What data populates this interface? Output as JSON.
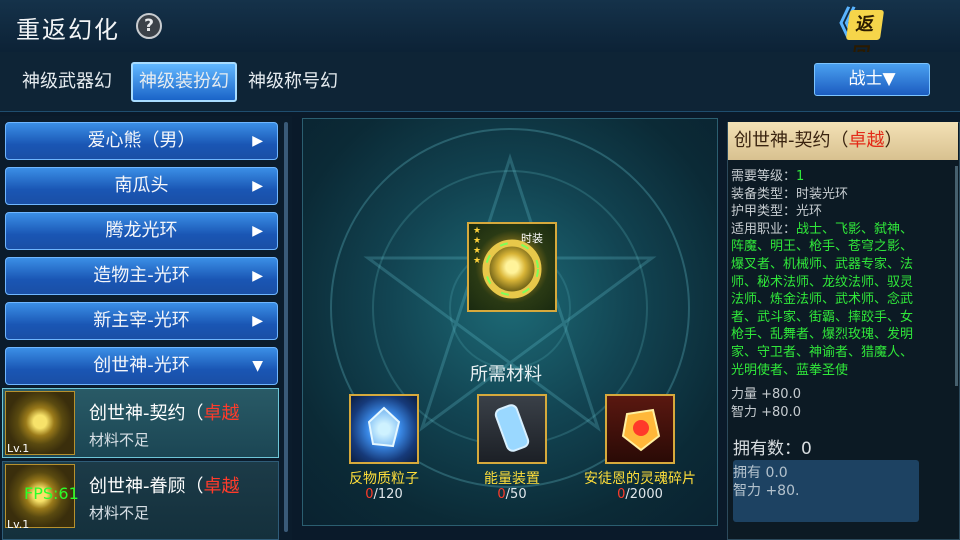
{
  "header": {
    "title": "重返幻化",
    "help_icon": "question-icon",
    "help_glyph": "?",
    "back_label": "返回",
    "back_arrows": "《"
  },
  "tabs": [
    {
      "label": "神级武器幻",
      "active": false
    },
    {
      "label": "神级装扮幻",
      "active": true
    },
    {
      "label": "神级称号幻",
      "active": false
    }
  ],
  "class_dropdown": {
    "label": "战士▼"
  },
  "list": {
    "categories": [
      {
        "label": "爱心熊（男）",
        "arrow": "▶"
      },
      {
        "label": "南瓜头",
        "arrow": "▶"
      },
      {
        "label": "腾龙光环",
        "arrow": "▶"
      },
      {
        "label": "造物主-光环",
        "arrow": "▶"
      },
      {
        "label": "新主宰-光环",
        "arrow": "▶"
      },
      {
        "label": "创世神-光环",
        "arrow": "▼"
      }
    ],
    "items": [
      {
        "name": "创世神-契约（",
        "tag": "卓越",
        "status": "材料不足",
        "level": "Lv.1",
        "selected": true
      },
      {
        "name": "创世神-眷顾（",
        "tag": "卓越",
        "status": "材料不足",
        "level": "Lv.1",
        "selected": false
      }
    ],
    "fps": "FPS:61"
  },
  "center": {
    "item_type": "时装",
    "stars": "★★★★",
    "materials_title": "所需材料",
    "materials": [
      {
        "name": "反物质粒子",
        "have": "0",
        "need": "/120",
        "icon": "crystal-icon"
      },
      {
        "name": "能量装置",
        "have": "0",
        "need": "/50",
        "icon": "canister-icon"
      },
      {
        "name": "安徒恩的灵魂碎片",
        "have": "0",
        "need": "/2000",
        "icon": "soul-shard-icon"
      }
    ]
  },
  "detail": {
    "title": "创世神-契约（",
    "tag": "卓越",
    "close_paren": "）",
    "props": [
      {
        "label": "需要等级：",
        "value": "1"
      },
      {
        "label": "装备类型：",
        "value": "时装光环"
      },
      {
        "label": "护甲类型：",
        "value": "光环"
      }
    ],
    "jobs_label": "适用职业：",
    "jobs_lines": [
      "战士、飞影、弑神、",
      "阵魔、明王、枪手、苍穹之影、",
      "爆叉者、机械师、武器专家、法",
      "师、秘术法师、龙纹法师、驭灵",
      "法师、炼金法师、武术师、念武",
      "者、武斗家、街霸、摔跤手、女",
      "枪手、乱舞者、爆烈玫瑰、发明",
      "家、守卫者、神谕者、猎魔人、",
      "光明使者、蓝拳圣使"
    ],
    "stats": [
      "力量 +80.0",
      "智力 +80.0"
    ],
    "own": "拥有数：0",
    "ghost_lines": [
      "拥有  0.0",
      "智力 +80."
    ]
  }
}
